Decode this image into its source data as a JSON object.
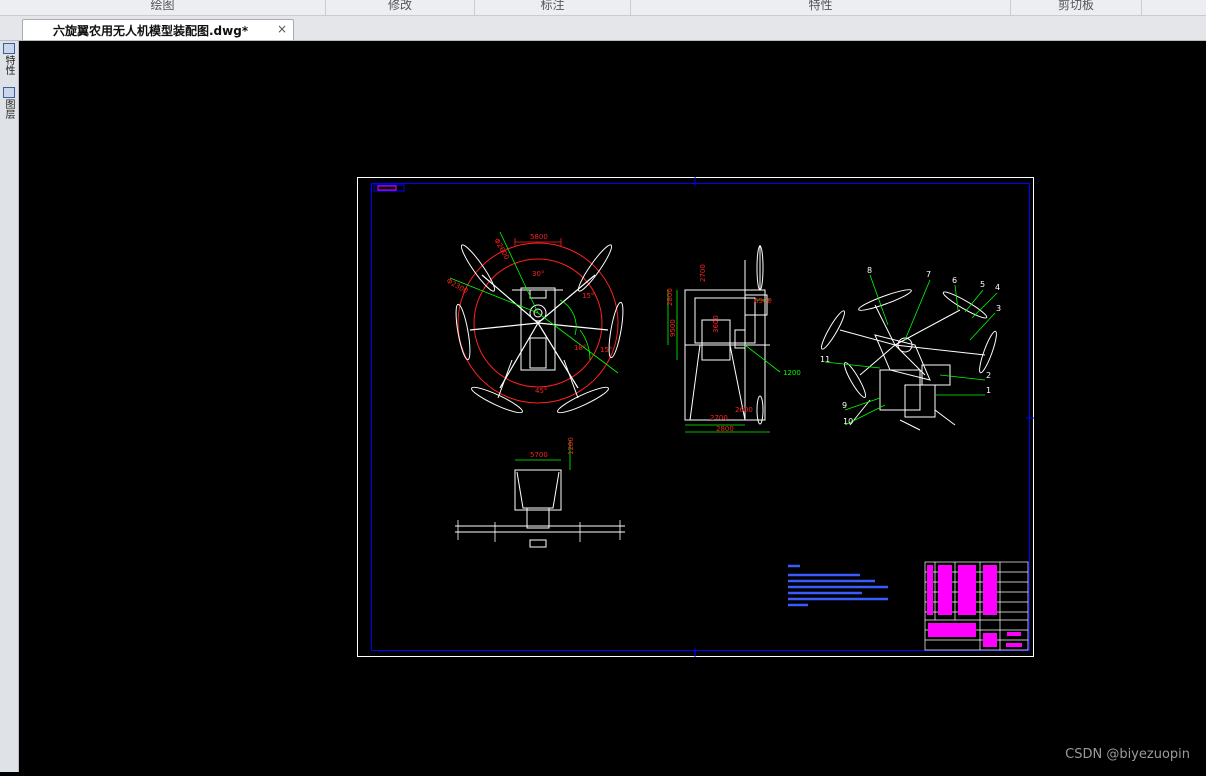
{
  "ribbon": {
    "groups": [
      "绘图",
      "修改",
      "标注",
      "特性",
      "剪切板"
    ]
  },
  "document_tab": {
    "title": "六旋翼农用无人机模型装配图.dwg*",
    "close_glyph": "×"
  },
  "left_panel": {
    "buttons": [
      "特性",
      "图层"
    ]
  },
  "drawing": {
    "views": [
      "top-view",
      "side-view",
      "front-view",
      "isometric-view"
    ],
    "dims": {
      "top": [
        "5800",
        "Φ2600",
        "Φ2300",
        "30°",
        "15°",
        "45°",
        "18°",
        "15°"
      ],
      "side": [
        "2700",
        "6500",
        "9500",
        "3600",
        "2600",
        "1200",
        "2700",
        "2800",
        "2800"
      ],
      "front": [
        "5700",
        "1200"
      ],
      "balloons": [
        "8",
        "7",
        "6",
        "5",
        "4",
        "3",
        "2",
        "1",
        "11",
        "9",
        "10"
      ]
    },
    "colors": {
      "border": "#ffffff",
      "frame": "#0000ff",
      "geometry": "#ffffff",
      "dimension": "#ff2020",
      "leader": "#00ff00",
      "annotation_text": "#00ffff",
      "notes": "#3a5cff",
      "title_block_fill": "#ff00ff"
    }
  },
  "watermark": "CSDN @biyezuopin"
}
